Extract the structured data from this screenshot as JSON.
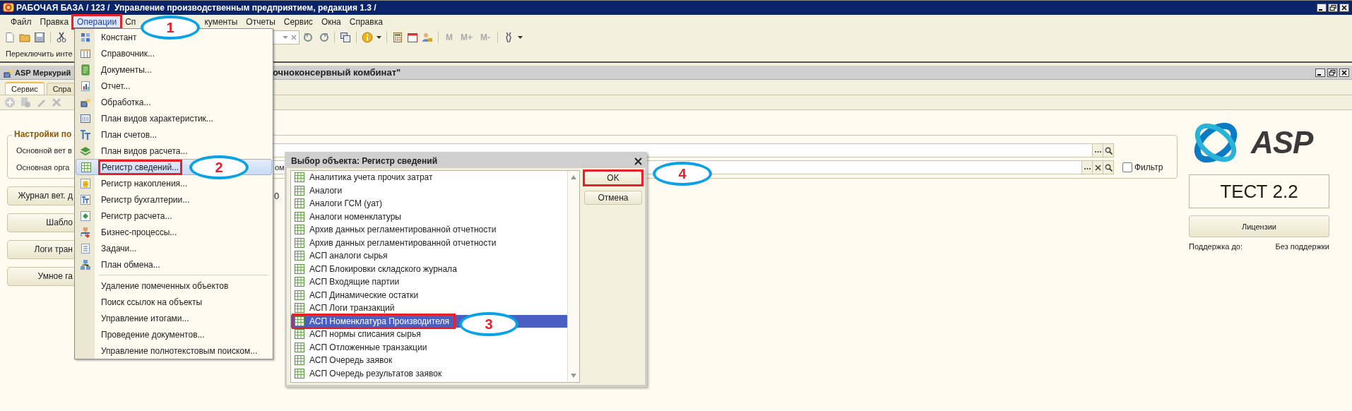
{
  "window": {
    "title": "РАБОЧАЯ БАЗА / 123 /  Управление производственным предприятием, редакция 1.3 /"
  },
  "menu_bar": [
    {
      "label": "Файл",
      "selected": false,
      "marked": false
    },
    {
      "label": "Правка",
      "selected": false,
      "marked": false
    },
    {
      "label": "Операции",
      "selected": true,
      "marked": true
    },
    {
      "label": "Сп",
      "selected": false,
      "marked": false
    },
    {
      "label": "кументы",
      "selected": false,
      "marked": false
    },
    {
      "label": "Отчеты",
      "selected": false,
      "marked": false
    },
    {
      "label": "Сервис",
      "selected": false,
      "marked": false
    },
    {
      "label": "Окна",
      "selected": false,
      "marked": false
    },
    {
      "label": "Справка",
      "selected": false,
      "marked": false
    }
  ],
  "toolbar_memory": [
    "M",
    "M+",
    "M-"
  ],
  "switch_bar": "Переключить инте",
  "document": {
    "title": "ASP Меркурий",
    "title_tail": "очноконсервный комбинат\""
  },
  "tabs": [
    {
      "label": "Сервис",
      "selected": true
    },
    {
      "label": "Спра",
      "selected": false
    }
  ],
  "settings": {
    "title": "Настройки по",
    "fields": [
      {
        "label": "Основной вет в",
        "clear_button": false
      },
      {
        "label": "Основная орга",
        "value": "ом",
        "clear_button": true
      }
    ],
    "filter": {
      "label": "Фильтр",
      "checked": false
    }
  },
  "action_buttons": [
    "Журнал вет. д",
    "Шабло",
    "Логи тран",
    "Умное га"
  ],
  "fragment": "0",
  "side_panel": {
    "logo_text": "ASP",
    "edition": "ТЕСТ 2.2",
    "licenses_button": "Лицензии",
    "support_label": "Поддержка до:",
    "support_value": "Без поддержки"
  },
  "operations_menu": [
    {
      "label": "Констант",
      "kind": "command",
      "selected": false,
      "marked": false
    },
    {
      "label": "Справочник...",
      "kind": "command",
      "selected": false,
      "marked": false
    },
    {
      "label": "Документы...",
      "kind": "command",
      "selected": false,
      "marked": false
    },
    {
      "label": "Отчет...",
      "kind": "command",
      "selected": false,
      "marked": false
    },
    {
      "label": "Обработка...",
      "kind": "command",
      "selected": false,
      "marked": false
    },
    {
      "label": "План видов характеристик...",
      "kind": "command",
      "selected": false,
      "marked": false
    },
    {
      "label": "План счетов...",
      "kind": "command",
      "selected": false,
      "marked": false
    },
    {
      "label": "План видов расчета...",
      "kind": "command",
      "selected": false,
      "marked": false
    },
    {
      "label": "Регистр сведений...",
      "kind": "command",
      "selected": true,
      "marked": true
    },
    {
      "label": "Регистр накопления...",
      "kind": "command",
      "selected": false,
      "marked": false
    },
    {
      "label": "Регистр бухгалтерии...",
      "kind": "command",
      "selected": false,
      "marked": false
    },
    {
      "label": "Регистр расчета...",
      "kind": "command",
      "selected": false,
      "marked": false
    },
    {
      "label": "Бизнес-процессы...",
      "kind": "command",
      "selected": false,
      "marked": false
    },
    {
      "label": "Задачи...",
      "kind": "command",
      "selected": false,
      "marked": false
    },
    {
      "label": "План обмена...",
      "kind": "command",
      "selected": false,
      "marked": false
    },
    {
      "kind": "separator"
    },
    {
      "label": "Удаление помеченных объектов",
      "kind": "action",
      "selected": false,
      "marked": false
    },
    {
      "label": "Поиск ссылок на объекты",
      "kind": "action",
      "selected": false,
      "marked": false
    },
    {
      "label": "Управление итогами...",
      "kind": "action",
      "selected": false,
      "marked": false
    },
    {
      "label": "Проведение документов...",
      "kind": "action",
      "selected": false,
      "marked": false
    },
    {
      "label": "Управление полнотекстовым поиском...",
      "kind": "action",
      "selected": false,
      "marked": false
    }
  ],
  "dialog": {
    "title": "Выбор объекта: Регистр сведений",
    "items": [
      {
        "label": "Аналитика учета прочих затрат",
        "selected": false,
        "marked": false
      },
      {
        "label": "Аналоги",
        "selected": false,
        "marked": false
      },
      {
        "label": "Аналоги ГСМ (уат)",
        "selected": false,
        "marked": false
      },
      {
        "label": "Аналоги номенклатуры",
        "selected": false,
        "marked": false
      },
      {
        "label": "Архив данных регламентированной отчетности",
        "selected": false,
        "marked": false
      },
      {
        "label": "Архив данных регламентированной отчетности",
        "selected": false,
        "marked": false
      },
      {
        "label": "АСП аналоги сырья",
        "selected": false,
        "marked": false
      },
      {
        "label": "АСП Блокировки складского журнала",
        "selected": false,
        "marked": false
      },
      {
        "label": "АСП Входящие партии",
        "selected": false,
        "marked": false
      },
      {
        "label": "АСП Динамические остатки",
        "selected": false,
        "marked": false
      },
      {
        "label": "АСП Логи транзакций",
        "selected": false,
        "marked": false
      },
      {
        "label": "АСП Номенклатура Производителя",
        "selected": true,
        "marked": true
      },
      {
        "label": "АСП нормы списания сырья",
        "selected": false,
        "marked": false
      },
      {
        "label": "АСП Отложенные транзакции",
        "selected": false,
        "marked": false
      },
      {
        "label": "АСП Очередь заявок",
        "selected": false,
        "marked": false
      },
      {
        "label": "АСП Очередь результатов заявок",
        "selected": false,
        "marked": false
      }
    ],
    "buttons": [
      {
        "label": "OK",
        "kind": "default",
        "marked": true
      },
      {
        "label": "Отмена",
        "kind": "normal",
        "marked": false
      }
    ]
  },
  "callouts": [
    "1",
    "2",
    "3",
    "4"
  ]
}
